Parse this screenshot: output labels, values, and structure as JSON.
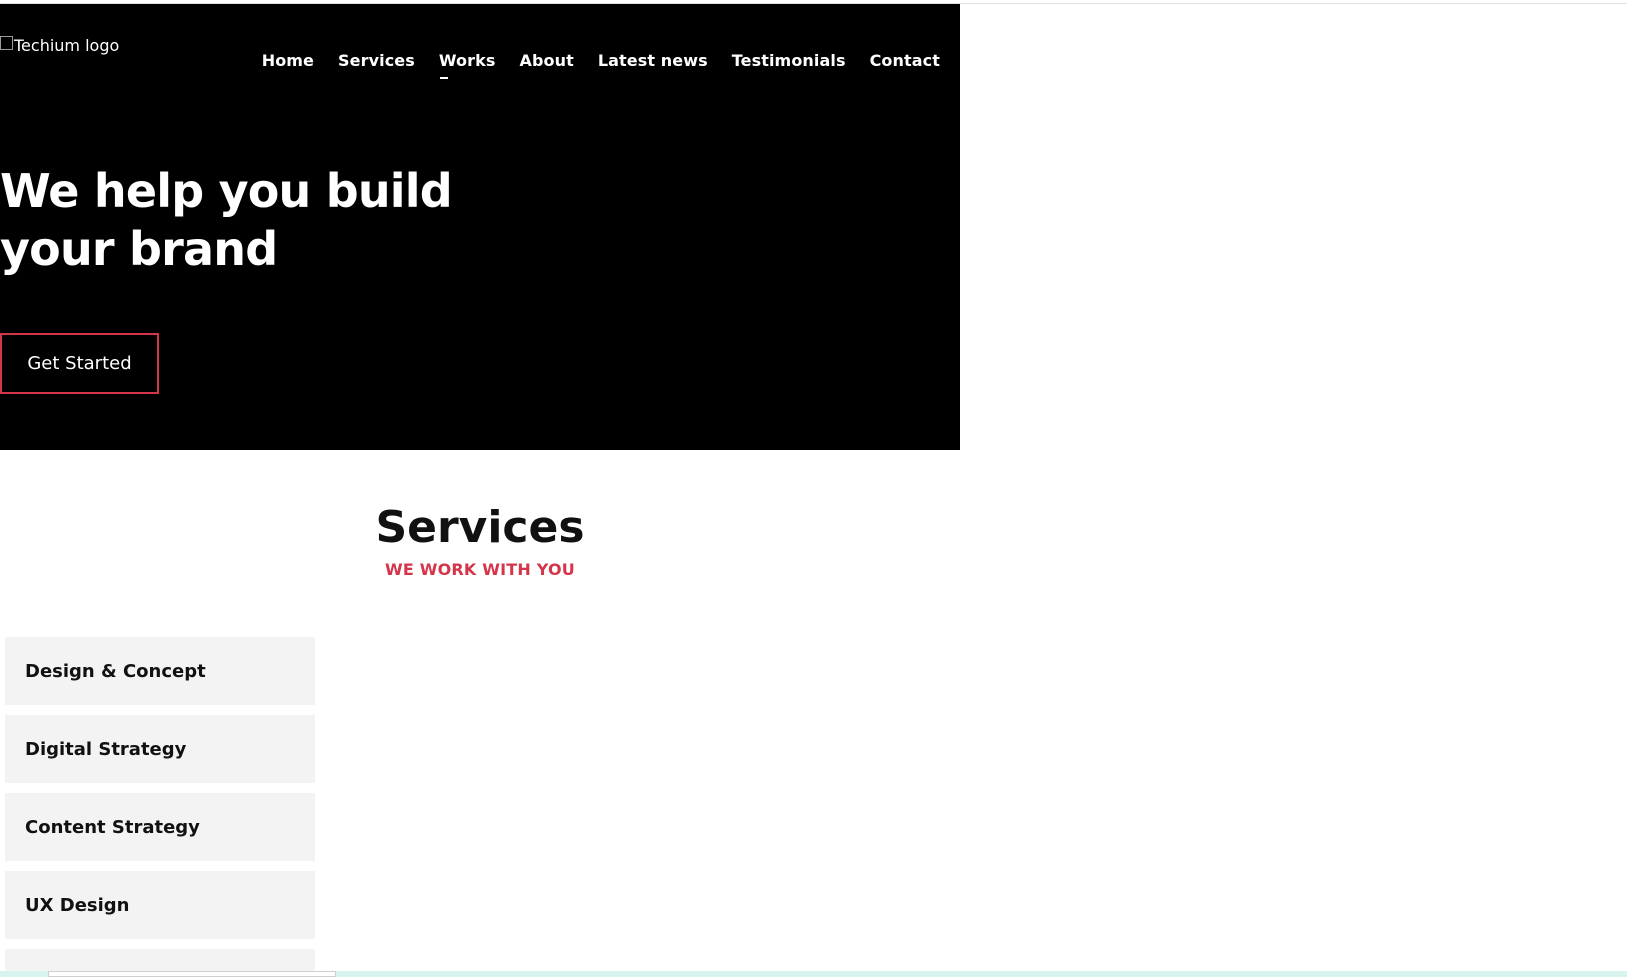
{
  "logo": {
    "alt_text": "Techium logo"
  },
  "nav": {
    "items": [
      "Home",
      "Services",
      "Works",
      "About",
      "Latest news",
      "Testimonials",
      "Contact"
    ],
    "active": "Works"
  },
  "hero": {
    "title": "We help you build your brand",
    "cta_label": "Get Started"
  },
  "services": {
    "title": "Services",
    "subtitle": "WE WORK WITH YOU",
    "items": [
      "Design & Concept",
      "Digital Strategy",
      "Content Strategy",
      "UX Design"
    ]
  },
  "colors": {
    "hero_background": "#000000",
    "accent": "#d6344a",
    "item_background": "#f3f3f3"
  }
}
